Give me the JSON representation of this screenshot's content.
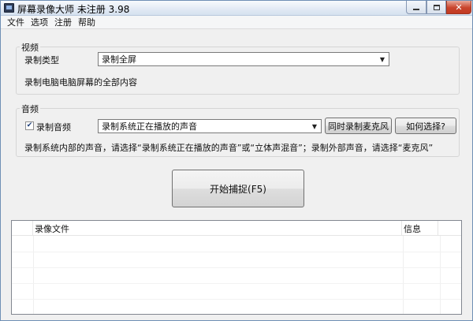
{
  "window": {
    "title": "屏幕录像大师 未注册 3.98"
  },
  "menu": {
    "items": [
      {
        "label": "文件"
      },
      {
        "label": "选项"
      },
      {
        "label": "注册"
      },
      {
        "label": "帮助"
      }
    ]
  },
  "video": {
    "group_title": "视频",
    "record_type_label": "录制类型",
    "record_type_value": "录制全屏",
    "description": "录制电脑电脑屏幕的全部内容"
  },
  "audio": {
    "group_title": "音频",
    "checkbox_label": "录制音频",
    "checkbox_checked": true,
    "source_value": "录制系统正在播放的声音",
    "mic_button": "同时录制麦克风",
    "how_button": "如何选择?",
    "hint": "录制系统内部的声音，请选择“录制系统正在播放的声音”或“立体声混音”；录制外部声音，请选择“麦克风”"
  },
  "capture": {
    "start_label": "开始捕捉(F5)"
  },
  "file_list": {
    "columns": [
      {
        "label": ""
      },
      {
        "label": "录像文件"
      },
      {
        "label": "信息"
      },
      {
        "label": ""
      }
    ],
    "rows": []
  }
}
